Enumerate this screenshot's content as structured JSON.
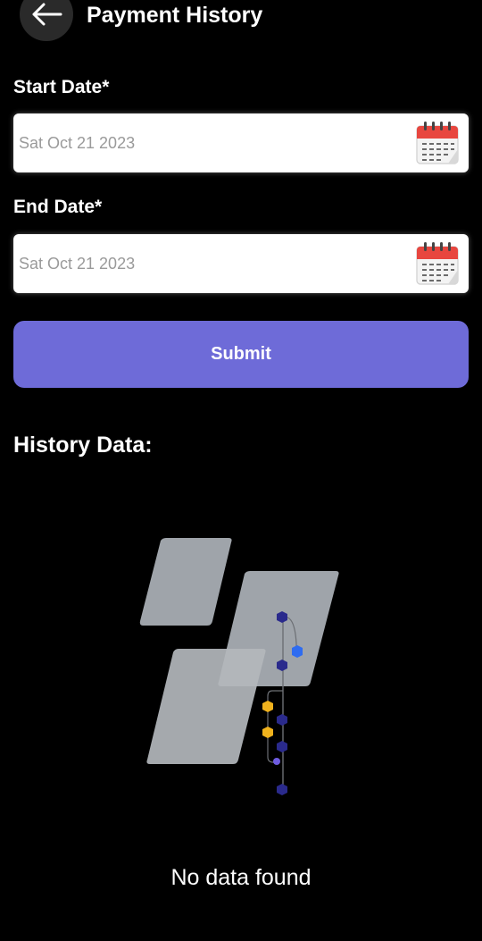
{
  "header": {
    "title": "Payment History",
    "back_icon": "arrow-left-icon"
  },
  "form": {
    "start_label": "Start Date*",
    "start_value": "Sat Oct 21 2023",
    "end_label": "End Date*",
    "end_value": "Sat Oct 21 2023",
    "calendar_icon": "calendar-icon",
    "submit_label": "Submit"
  },
  "history": {
    "title": "History Data:",
    "empty_text": "No data found",
    "illustration": "empty-data-illustration"
  },
  "colors": {
    "background": "#000000",
    "accent": "#6e6bd8",
    "field_bg": "#ffffff",
    "placeholder": "#9a9a9a",
    "calendar_red": "#e8463f"
  }
}
